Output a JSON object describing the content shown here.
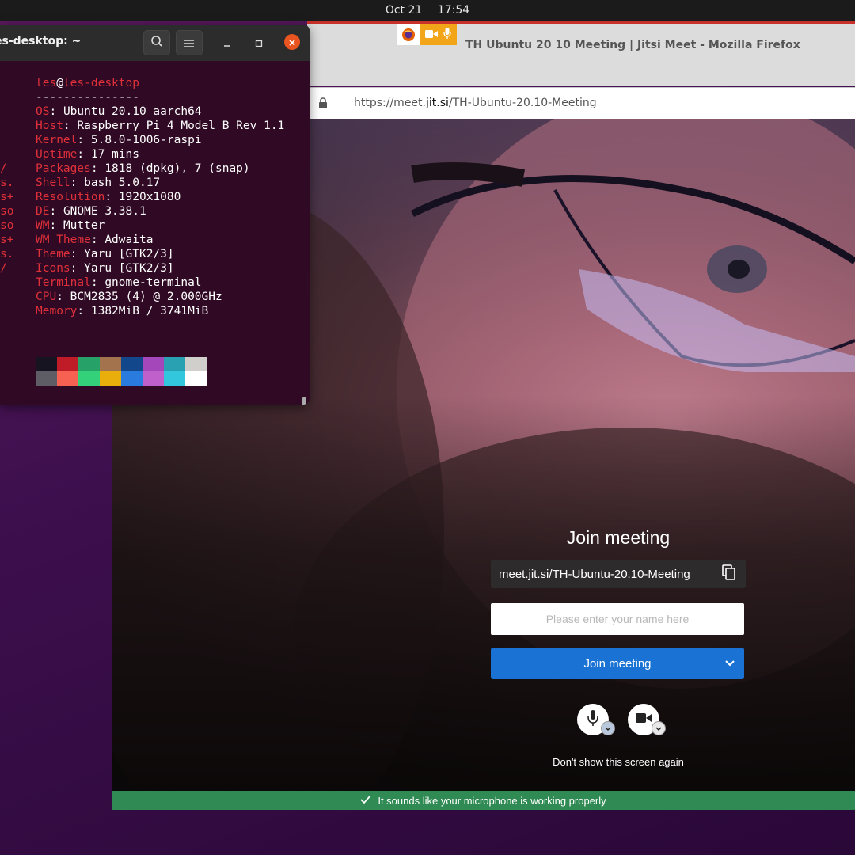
{
  "topbar": {
    "date": "Oct 21",
    "time": "17:54"
  },
  "firefox": {
    "window_title": "TH Ubuntu 20 10 Meeting | Jitsi Meet - Mozilla Firefox",
    "url_prefix": "https://meet.",
    "url_domain": "jit.si",
    "url_path": "/TH-Ubuntu-20.10-Meeting"
  },
  "jitsi": {
    "title": "Join meeting",
    "meeting_url": "meet.jit.si/TH-Ubuntu-20.10-Meeting",
    "name_placeholder": "Please enter your name here",
    "join_label": "Join meeting",
    "dont_show": "Don't show this screen again",
    "mic_status": "It sounds like your microphone is working properly",
    "status_color": "#2f8a53",
    "join_color": "#1a73d4"
  },
  "terminal": {
    "title": "es-desktop: ~",
    "user": "les",
    "at": "@",
    "host": "les-desktop",
    "separator": "---------------",
    "info": [
      {
        "key": "OS",
        "value": "Ubuntu 20.10 aarch64"
      },
      {
        "key": "Host",
        "value": "Raspberry Pi 4 Model B Rev 1.1"
      },
      {
        "key": "Kernel",
        "value": "5.8.0-1006-raspi"
      },
      {
        "key": "Uptime",
        "value": "17 mins"
      },
      {
        "key": "Packages",
        "value": "1818 (dpkg), 7 (snap)"
      },
      {
        "key": "Shell",
        "value": "bash 5.0.17"
      },
      {
        "key": "Resolution",
        "value": "1920x1080"
      },
      {
        "key": "DE",
        "value": "GNOME 3.38.1"
      },
      {
        "key": "WM",
        "value": "Mutter"
      },
      {
        "key": "WM Theme",
        "value": "Adwaita"
      },
      {
        "key": "Theme",
        "value": "Yaru [GTK2/3]"
      },
      {
        "key": "Icons",
        "value": "Yaru [GTK2/3]"
      },
      {
        "key": "Terminal",
        "value": "gnome-terminal"
      },
      {
        "key": "CPU",
        "value": "BCM2835 (4) @ 2.000GHz"
      },
      {
        "key": "Memory",
        "value": "1382MiB / 3741MiB"
      }
    ],
    "logo_fragments": [
      "/",
      "s.",
      "s+",
      "so",
      "so",
      "s+",
      "s.",
      "/"
    ],
    "palette_top": [
      "#171421",
      "#c01c28",
      "#26a269",
      "#a2734c",
      "#12488b",
      "#a347ba",
      "#2aa1b3",
      "#d0cfcc"
    ],
    "palette_bottom": [
      "#5e5c64",
      "#f66151",
      "#33d17a",
      "#e9ad0c",
      "#2a7bde",
      "#c061cb",
      "#33c7de",
      "#ffffff"
    ],
    "background": "#300a24",
    "accent": "#e0303a"
  },
  "icons": [
    "firefox-icon",
    "camera-icon",
    "microphone-icon",
    "lock-icon",
    "copy-icon",
    "chevron-down-icon",
    "check-icon",
    "search-icon",
    "hamburger-icon",
    "minimize-icon",
    "maximize-icon",
    "close-icon"
  ]
}
